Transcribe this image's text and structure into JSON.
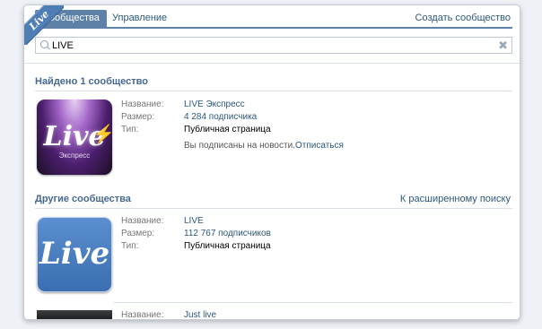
{
  "corner_badge": "Live",
  "tabs": {
    "communities": "Сообщества",
    "manage": "Управление",
    "create": "Создать сообщество"
  },
  "search": {
    "value": "LIVE",
    "placeholder": ""
  },
  "found_title": "Найдено 1 сообщество",
  "others_title": "Другие сообщества",
  "advanced_search": "К расширенному поиску",
  "labels": {
    "name": "Название:",
    "size": "Размер:",
    "type": "Тип:"
  },
  "found": {
    "logo": "Live",
    "logo_sub": "Экспресс",
    "name": "LIVE Экспресс",
    "size": "4 284 подписчика",
    "type": "Публичная страница",
    "subscribed_note": "Вы подписаны на новости.",
    "unsubscribe": "Отписаться"
  },
  "others": [
    {
      "logo": "Live",
      "name": "LIVE",
      "size": "112 767 подписчиков",
      "type": "Публичная страница"
    },
    {
      "name": "Just live"
    }
  ],
  "colors": {
    "accent": "#5e81a8",
    "link": "#2b587a",
    "section": "#45688e"
  }
}
